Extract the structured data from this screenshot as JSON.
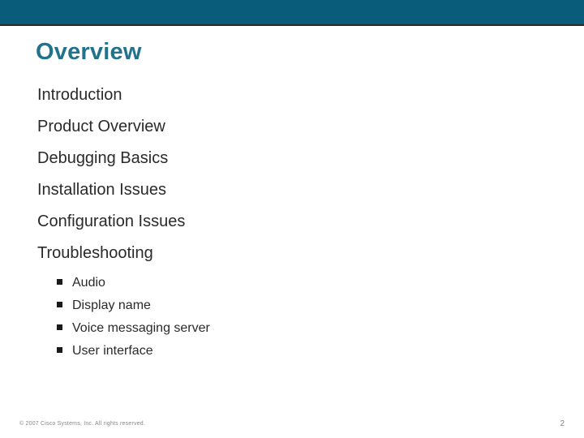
{
  "title": "Overview",
  "items": [
    {
      "label": "Introduction"
    },
    {
      "label": "Product Overview"
    },
    {
      "label": "Debugging Basics"
    },
    {
      "label": "Installation Issues"
    },
    {
      "label": "Configuration Issues"
    },
    {
      "label": "Troubleshooting"
    }
  ],
  "subitems": [
    {
      "label": "Audio"
    },
    {
      "label": "Display name"
    },
    {
      "label": "Voice messaging server"
    },
    {
      "label": "User interface"
    }
  ],
  "footer": {
    "copyright": "© 2007 Cisco Systems, Inc. All rights reserved.",
    "page": "2"
  }
}
